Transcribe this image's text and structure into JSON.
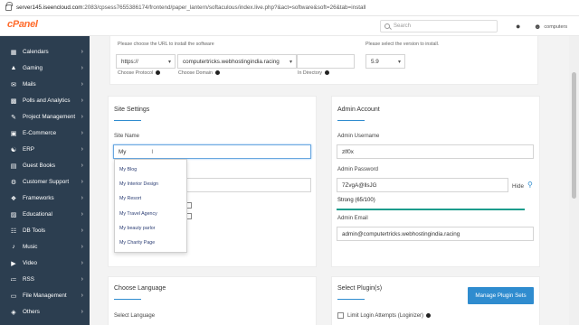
{
  "browser": {
    "url_host": "server145.iseencloud.com",
    "url_rest": ":2083/cpsess7655386174/frontend/paper_lantern/softaculous/index.live.php?&act=software&soft=26&tab=install"
  },
  "header": {
    "logo": "cPanel",
    "search_placeholder": "Search",
    "user_label": "computers"
  },
  "sidebar": {
    "items": [
      {
        "label": "Calendars",
        "icon": "calendar-icon"
      },
      {
        "label": "Gaming",
        "icon": "gamepad-icon"
      },
      {
        "label": "Mails",
        "icon": "mail-icon"
      },
      {
        "label": "Polls and Analytics",
        "icon": "poll-icon"
      },
      {
        "label": "Project Management",
        "icon": "project-icon"
      },
      {
        "label": "E-Commerce",
        "icon": "cart-icon"
      },
      {
        "label": "ERP",
        "icon": "erp-icon"
      },
      {
        "label": "Guest Books",
        "icon": "book-icon"
      },
      {
        "label": "Customer Support",
        "icon": "support-icon"
      },
      {
        "label": "Frameworks",
        "icon": "frameworks-icon"
      },
      {
        "label": "Educational",
        "icon": "education-icon"
      },
      {
        "label": "DB Tools",
        "icon": "database-icon"
      },
      {
        "label": "Music",
        "icon": "music-icon"
      },
      {
        "label": "Video",
        "icon": "video-icon"
      },
      {
        "label": "RSS",
        "icon": "rss-icon"
      },
      {
        "label": "File Management",
        "icon": "folder-icon"
      },
      {
        "label": "Others",
        "icon": "others-icon"
      }
    ]
  },
  "install_url": {
    "hint": "Please choose the URL to install the software",
    "protocol": "https://",
    "domain": "computertricks.webhostingindia.racing",
    "protocol_label": "Choose Protocol",
    "domain_label": "Choose Domain",
    "directory_label": "In Directory"
  },
  "version": {
    "hint": "Please select the version to install.",
    "value": "5.9"
  },
  "site_settings": {
    "title": "Site Settings",
    "site_name_label": "Site Name",
    "site_name_value": "My",
    "suggestions": [
      "My Blog",
      "My Interior Design",
      "My Resort",
      "My Travel Agency",
      "My beauty parlor",
      "My Charity Page"
    ]
  },
  "admin_account": {
    "title": "Admin Account",
    "username_label": "Admin Username",
    "username_value": "zlf0x",
    "password_label": "Admin Password",
    "password_value": "7ZvgA@llsJG",
    "hide_label": "Hide",
    "strength_text": "Strong (65/100)",
    "strength_percent": 100,
    "email_label": "Admin Email",
    "email_value": "admin@computertricks.webhostingindia.racing"
  },
  "choose_language": {
    "title": "Choose Language",
    "select_label": "Select Language"
  },
  "plugins": {
    "title": "Select Plugin(s)",
    "manage_button": "Manage Plugin Sets",
    "item_1": "Limit Login Attempts (Loginizer)"
  },
  "colors": {
    "sidebar": "#2c3e50",
    "accent": "#2f8ccf",
    "brand": "#ff6c2c"
  }
}
